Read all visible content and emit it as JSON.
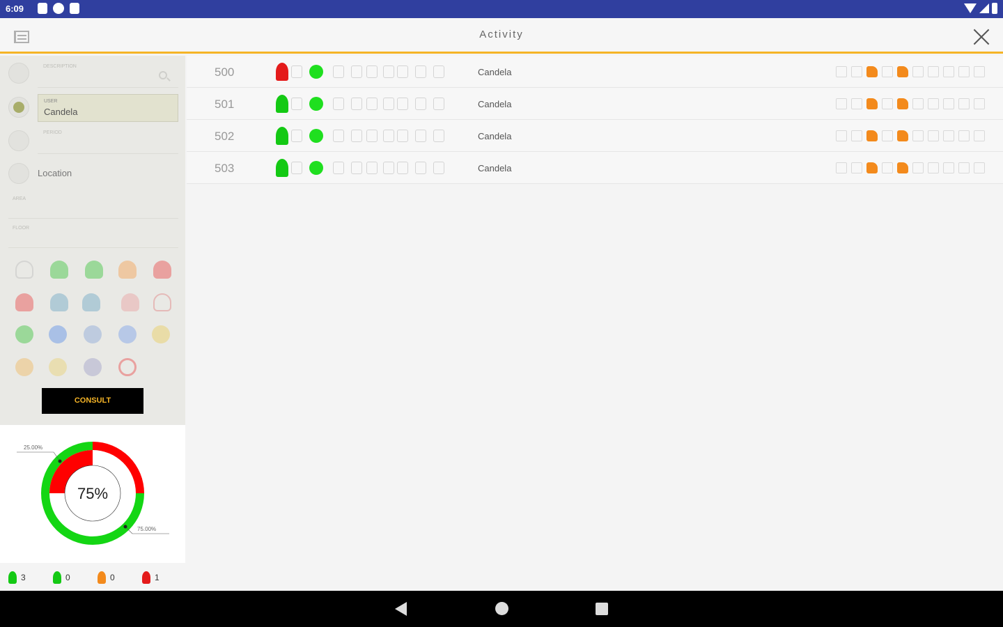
{
  "status_bar": {
    "time": "6:09"
  },
  "app_bar": {
    "title": "Activity"
  },
  "filters": {
    "description": {
      "label": "DESCRIPTION",
      "value": ""
    },
    "user": {
      "label": "USER",
      "value": "Candela"
    },
    "period": {
      "label": "PERIOD",
      "value": ""
    },
    "location_label": "Location",
    "area": {
      "label": "AREA",
      "value": ""
    },
    "floor": {
      "label": "FLOOR",
      "value": ""
    },
    "consult_label": "CONSULT"
  },
  "donut": {
    "center_label": "75%",
    "segments": [
      {
        "label": "25.00%",
        "value": 25,
        "color": "#ff0000"
      },
      {
        "label": "75.00%",
        "value": 75,
        "color": "#14d614"
      }
    ]
  },
  "counts": [
    {
      "color": "#14c914",
      "value": "3"
    },
    {
      "color": "#14c914",
      "value": "0"
    },
    {
      "color": "#f38a1c",
      "value": "0"
    },
    {
      "color": "#e41b1b",
      "value": "1"
    }
  ],
  "rows": [
    {
      "number": "500",
      "status_color": "#e41b1b",
      "user": "Candela"
    },
    {
      "number": "501",
      "status_color": "#14c914",
      "user": "Candela"
    },
    {
      "number": "502",
      "status_color": "#14c914",
      "user": "Candela"
    },
    {
      "number": "503",
      "status_color": "#14c914",
      "user": "Candela"
    }
  ],
  "colors": {
    "accent": "#f5b427",
    "status_bar": "#303f9f"
  }
}
